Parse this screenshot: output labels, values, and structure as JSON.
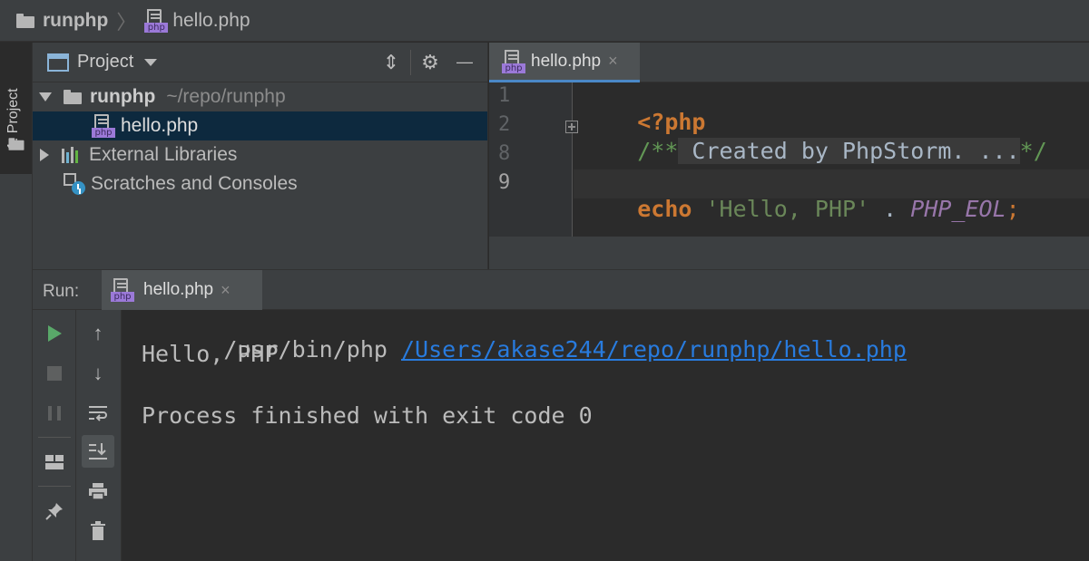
{
  "navbar": {
    "project_name": "runphp",
    "file_name": "hello.php",
    "separator": "〉",
    "file_badge": "php"
  },
  "left_strip": {
    "project_tab_label": "1: Project"
  },
  "project_panel": {
    "title": "Project",
    "tree": {
      "root_name": "runphp",
      "root_path": "~/repo/runphp",
      "file_name": "hello.php",
      "external_libraries": "External Libraries",
      "scratches": "Scratches and Consoles"
    }
  },
  "editor": {
    "tab_label": "hello.php",
    "line_numbers": [
      "1",
      "2",
      "8",
      "9"
    ],
    "code": {
      "open_tag": "<?php",
      "comment_start": "/**",
      "comment_folded": " Created by PhpStorm. ...",
      "comment_end": "*/",
      "echo_kw": "echo",
      "string_literal": "'Hello, PHP'",
      "concat_op": " . ",
      "constant": "PHP_EOL",
      "semicolon": ";"
    }
  },
  "run_panel": {
    "label": "Run:",
    "tab_label": "hello.php",
    "console": {
      "command": "/usr/bin/php ",
      "script_path": "/Users/akase244/repo/runphp/hello.php",
      "output": "Hello, PHP",
      "exit_message": "Process finished with exit code 0"
    }
  },
  "icons": {
    "close": "×",
    "arrow_up": "↑",
    "arrow_down": "↓",
    "gear": "⚙",
    "minimize": "—",
    "collapse": "⇕"
  },
  "colors": {
    "keyword": "#cc7832",
    "comment": "#629755",
    "string": "#6a8759",
    "constant": "#9876aa",
    "link": "#287bde",
    "selection": "#0d293e",
    "run_green": "#59a869"
  }
}
